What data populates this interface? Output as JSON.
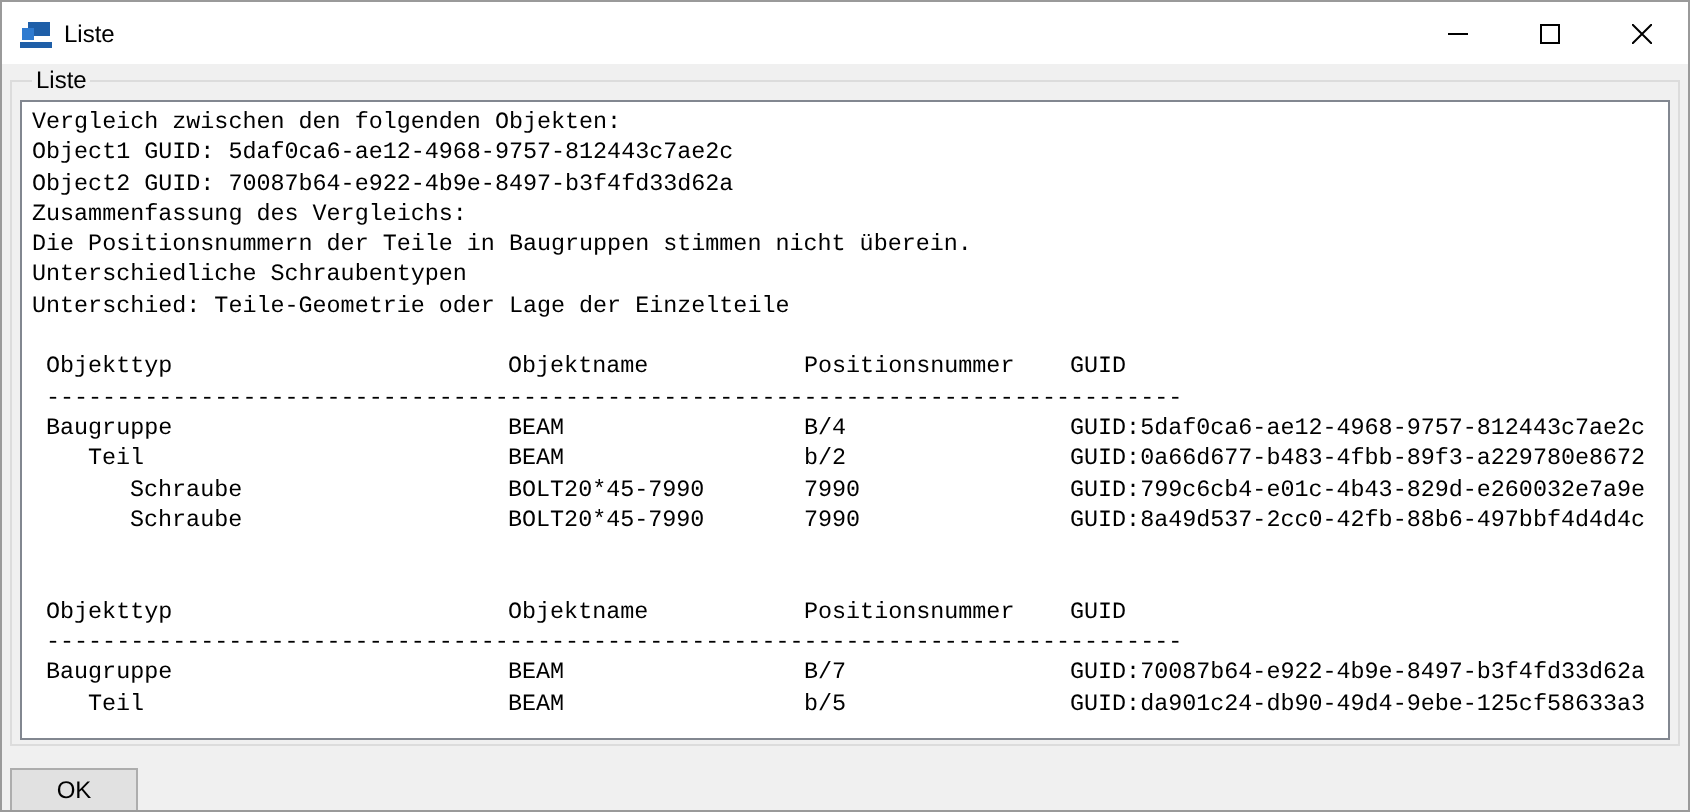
{
  "window": {
    "title": "Liste"
  },
  "group": {
    "title": "Liste"
  },
  "summary_lines": [
    "Vergleich zwischen den folgenden Objekten:",
    "Object1 GUID: 5daf0ca6-ae12-4968-9757-812443c7ae2c",
    "Object2 GUID: 70087b64-e922-4b9e-8497-b3f4fd33d62a",
    "Zusammenfassung des Vergleichs:",
    "Die Positionsnummern der Teile in Baugruppen stimmen nicht überein.",
    "Unterschiedliche Schraubentypen",
    "Unterschied: Teile-Geometrie oder Lage der Einzelteile"
  ],
  "tables": [
    {
      "columns": [
        "Objekttyp",
        "Objektname",
        "Positionsnummer",
        "GUID"
      ],
      "separator": "---------------------------------------------------------------------------------",
      "rows": [
        {
          "cells": [
            "Baugruppe",
            "BEAM",
            "B/4",
            "GUID:5daf0ca6-ae12-4968-9757-812443c7ae2c"
          ],
          "children": [
            {
              "cells": [
                "Teil",
                "BEAM",
                "b/2",
                "GUID:0a66d677-b483-4fbb-89f3-a229780e8672"
              ],
              "children": [
                {
                  "cells": [
                    "Schraube",
                    "BOLT20*45-7990",
                    "7990",
                    "GUID:799c6cb4-e01c-4b43-829d-e260032e7a9e"
                  ]
                },
                {
                  "cells": [
                    "Schraube",
                    "BOLT20*45-7990",
                    "7990",
                    "GUID:8a49d537-2cc0-42fb-88b6-497bbf4d4d4c"
                  ]
                }
              ]
            }
          ]
        }
      ]
    },
    {
      "columns": [
        "Objekttyp",
        "Objektname",
        "Positionsnummer",
        "GUID"
      ],
      "separator": "---------------------------------------------------------------------------------",
      "rows": [
        {
          "cells": [
            "Baugruppe",
            "BEAM",
            "B/7",
            "GUID:70087b64-e922-4b9e-8497-b3f4fd33d62a"
          ],
          "children": [
            {
              "cells": [
                "Teil",
                "BEAM",
                "b/5",
                "GUID:da901c24-db90-49d4-9ebe-125cf58633a3"
              ]
            }
          ]
        }
      ]
    }
  ],
  "buttons": [
    "OK"
  ]
}
